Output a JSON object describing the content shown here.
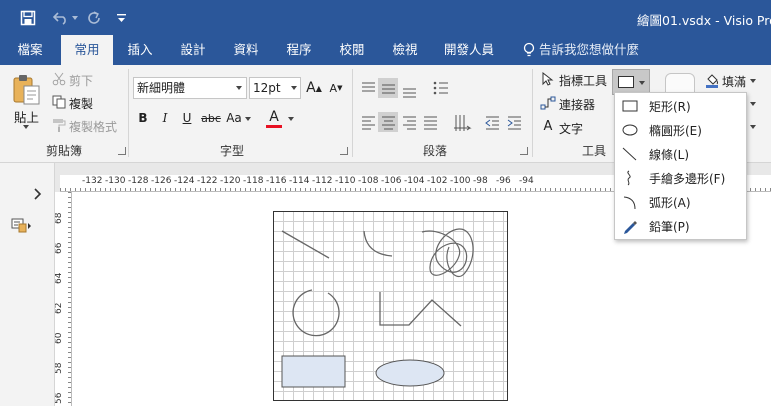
{
  "titlebar": {
    "title": "繪圖01.vsdx - Visio Pro",
    "save_icon": "save-icon",
    "undo_icon": "undo-icon",
    "redo_icon": "redo-icon",
    "qat_icon": "customize-quick-access-icon"
  },
  "tabs": [
    "檔案",
    "常用",
    "插入",
    "設計",
    "資料",
    "程序",
    "校閱",
    "檢視",
    "開發人員"
  ],
  "active_tab": "常用",
  "tell_me": "告訴我您想做什麼",
  "clipboard": {
    "paste": "貼上",
    "cut": "剪下",
    "copy": "複製",
    "format_painter": "複製格式",
    "group_label": "剪貼簿"
  },
  "font": {
    "name": "新細明體",
    "size": "12pt",
    "grow": "A",
    "shrink": "A",
    "bold": "B",
    "italic": "I",
    "underline": "U",
    "strike": "abc",
    "case": "Aa",
    "color_letter": "A",
    "group_label": "字型",
    "font_color": "#e81123"
  },
  "paragraph": {
    "group_label": "段落"
  },
  "tools": {
    "pointer": "指標工具",
    "connector": "連接器",
    "text": "文字",
    "group_label": "工具",
    "text_glyph": "A"
  },
  "shape_styles": {
    "fill": "填滿"
  },
  "shape_menu": [
    {
      "label": "矩形(R)",
      "icon": "rectangle-icon"
    },
    {
      "label": "橢圓形(E)",
      "icon": "ellipse-icon"
    },
    {
      "label": "線條(L)",
      "icon": "line-icon"
    },
    {
      "label": "手繪多邊形(F)",
      "icon": "freeform-icon"
    },
    {
      "label": "弧形(A)",
      "icon": "arc-icon"
    },
    {
      "label": "鉛筆(P)",
      "icon": "pencil-icon"
    }
  ],
  "ruler_h": [
    "-132",
    "-130",
    "-128",
    "-126",
    "-124",
    "-122",
    "-120",
    "-118",
    "-116",
    "-114",
    "-112",
    "-110",
    "-108",
    "-106",
    "-104",
    "-102",
    "-100",
    "-98",
    "-96",
    "-94"
  ],
  "ruler_v": [
    "68",
    "66",
    "64",
    "62",
    "60",
    "58",
    "56"
  ],
  "pane": {
    "expand_icon": "expand-chevron-icon",
    "shapes_icon": "shapes-pane-icon"
  },
  "colors": {
    "accent": "#2B579A",
    "shape_fill": "#dde6f3",
    "shape_stroke": "#555555"
  }
}
